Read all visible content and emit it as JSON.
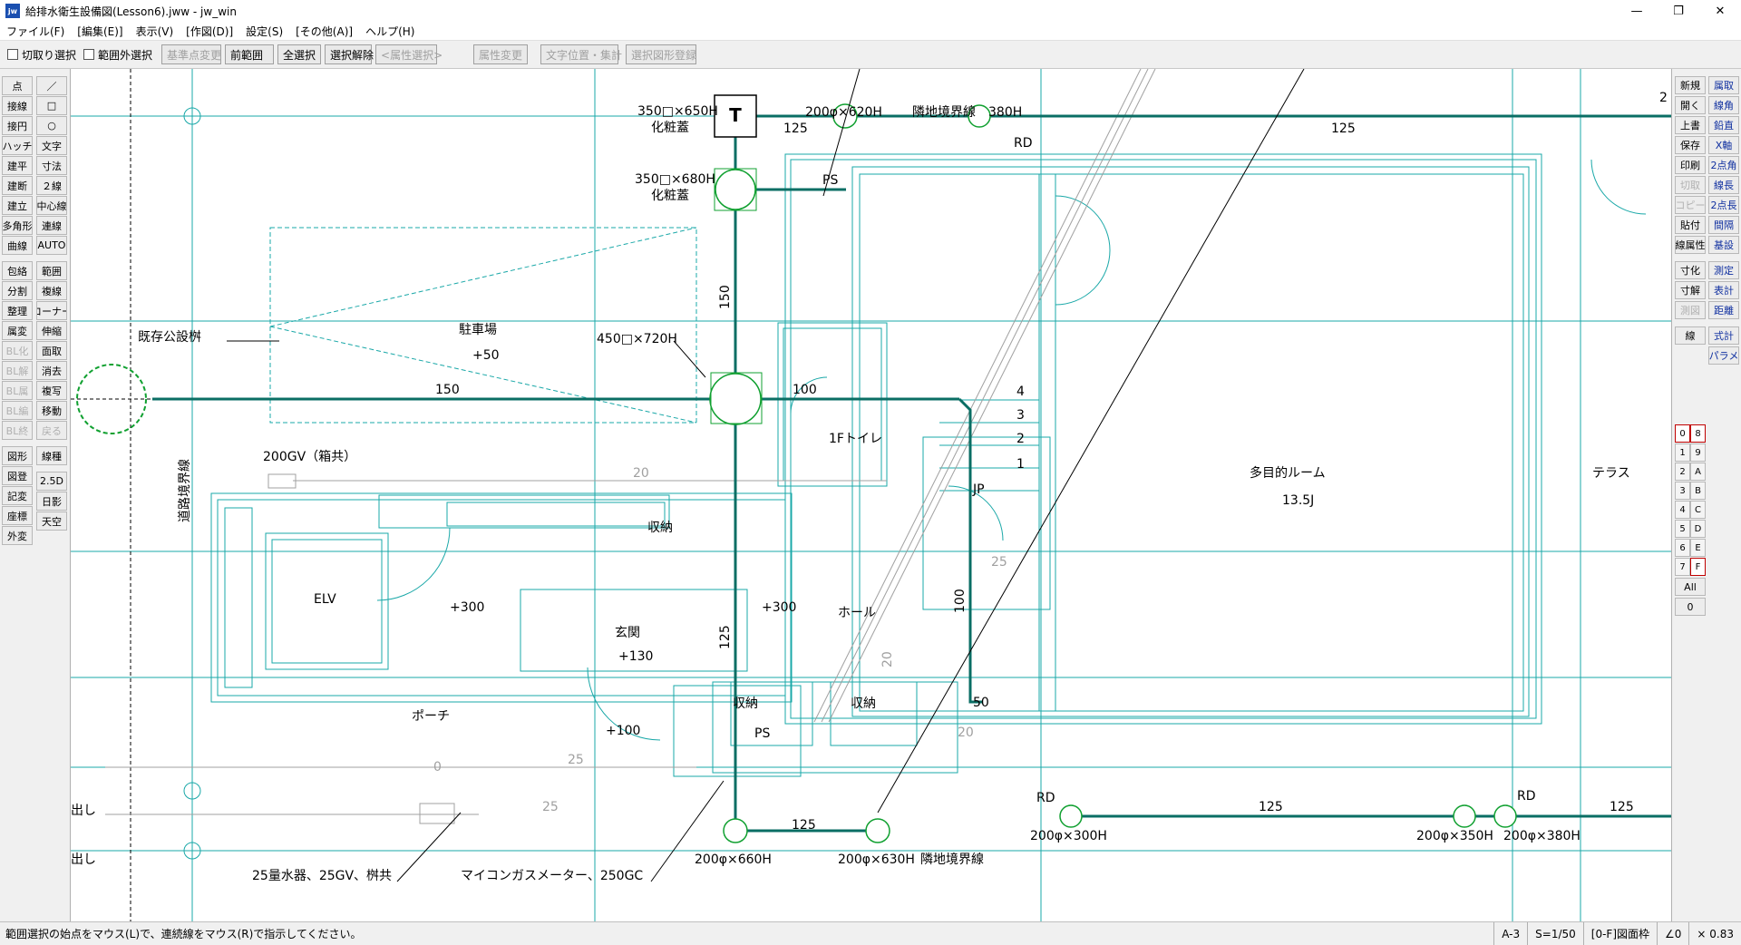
{
  "window": {
    "title": "給排水衛生設備図(Lesson6).jww - jw_win",
    "icon": "jw-app-icon"
  },
  "menubar": [
    "ファイル(F)",
    "[編集(E)]",
    "表示(V)",
    "[作図(D)]",
    "設定(S)",
    "[その他(A)]",
    "ヘルプ(H)"
  ],
  "toolbar": {
    "checkboxes": [
      "切取り選択",
      "範囲外選択"
    ],
    "buttons": [
      {
        "label": "基準点変更",
        "enabled": false
      },
      {
        "label": "前範囲",
        "enabled": true
      },
      {
        "label": "全選択",
        "enabled": true
      },
      {
        "label": "選択解除",
        "enabled": true
      },
      {
        "label": "<属性選択>",
        "enabled": false
      },
      {
        "label": "属性変更",
        "enabled": false
      },
      {
        "label": "文字位置・集計",
        "enabled": false
      },
      {
        "label": "選択図形登録",
        "enabled": false
      }
    ]
  },
  "left_tools": {
    "col_a": [
      "点",
      "接線",
      "接円",
      "ハッチ",
      "建平",
      "建断",
      "建立",
      "多角形",
      "曲線",
      "",
      "包絡",
      "分割",
      "整理",
      "属変",
      "BL化",
      "BL解",
      "BL属",
      "BL編",
      "BL終",
      "",
      "図形",
      "図登",
      "記変",
      "座標",
      "外変"
    ],
    "col_a_disabled": [
      "BL化",
      "BL解",
      "BL属",
      "BL編",
      "BL終"
    ],
    "col_b": [
      "／",
      "□",
      "○",
      "文字",
      "寸法",
      "２線",
      "中心線",
      "連線",
      "AUTO",
      "",
      "範囲",
      "複線",
      "コーナー",
      "伸縮",
      "面取",
      "消去",
      "複写",
      "移動",
      "戻る",
      "",
      "線種",
      "",
      "2.5D",
      "日影",
      "天空"
    ],
    "col_b_disabled": [
      "戻る"
    ]
  },
  "right_tools": {
    "col_a": [
      "新規",
      "開く",
      "上書",
      "保存",
      "印刷",
      "切取",
      "コピー",
      "貼付",
      "線属性",
      "",
      "寸化",
      "寸解",
      "測図",
      "",
      "線"
    ],
    "col_a_disabled": [
      "切取",
      "コピー",
      "測図"
    ],
    "col_b": [
      "属取",
      "線角",
      "鉛直",
      "X軸",
      "2点角",
      "線長",
      "2点長",
      "間隔",
      "基設",
      "",
      "測定",
      "表計",
      "距離",
      "",
      "式計",
      "パラメ"
    ],
    "layers_a": [
      "0",
      "1",
      "2",
      "3",
      "4",
      "5",
      "6",
      "7"
    ],
    "layers_b": [
      "8",
      "9",
      "A",
      "B",
      "C",
      "D",
      "E",
      "F"
    ],
    "layer_all": "All",
    "layer_zero": "0"
  },
  "drawing": {
    "labels": {
      "t_mark": "T",
      "box1_spec": "350□×650H",
      "box1_name": "化粧蓋",
      "box2_spec": "350□×680H",
      "box2_name": "化粧蓋",
      "box3_spec": "450□×720H",
      "top_spec1": "200φ×620H",
      "top_boundary": "隣地境界線",
      "top_spec2": "380H",
      "rd_top": "RD",
      "ps_top": "PS",
      "dim_125_a": "125",
      "dim_125_b": "125",
      "dim_150_v": "150",
      "dim_150_h": "150",
      "dim_100_h": "100",
      "dim_100_v": "100",
      "dim_125_v": "125",
      "dim_125_c": "125",
      "dim_125_d": "125",
      "dim_125_e": "125",
      "dim_50": "50",
      "dim_20": "20",
      "dim_20_b": "20",
      "dim_20_c": "20",
      "dim_25": "25",
      "dim_25_b": "25",
      "dim_25_c": "25",
      "dim_0": "0",
      "existing_basin": "既存公設桝",
      "road_boundary": "道路境界線",
      "parking": "駐車場",
      "parking_level": "+50",
      "gv200": "200GV（箱共）",
      "toilet": "1Fトイレ",
      "jp": "JP",
      "stair1": "1",
      "stair2": "2",
      "stair3": "3",
      "stair4": "4",
      "multi_room": "多目的ルーム",
      "multi_area": "13.5J",
      "terrace": "テラス",
      "storage1": "収納",
      "storage2": "収納",
      "storage3": "収納",
      "elv": "ELV",
      "plus300a": "+300",
      "plus300b": "+300",
      "hall": "ホール",
      "entrance": "玄関",
      "entrance_level": "+130",
      "porch": "ポーチ",
      "plus100": "+100",
      "ps_bottom": "PS",
      "rd_bl": "RD",
      "rd_br": "RD",
      "b_spec1": "200φ×660H",
      "b_spec2": "200φ×630H",
      "b_boundary": "隣地境界線",
      "b_spec3": "200φ×300H",
      "b_spec4": "200φ×350H",
      "b_spec5": "200φ×380H",
      "water_meter": "25量水器、25GV、桝共",
      "gas_meter": "マイコンガスメーター、250GC",
      "dashi1": "出し",
      "dashi2": "出し",
      "edge_2": "2"
    }
  },
  "statusbar": {
    "message": "範囲選択の始点をマウス(L)で、連続線をマウス(R)で指示してください。",
    "paper": "A-3",
    "scale": "S=1/50",
    "layer": "[0-F]図面枠",
    "angle": "∠0",
    "zoom": "× 0.83"
  },
  "colors": {
    "cyan": "#1aa8a8",
    "pipe": "#0a6e64",
    "green": "#10a030",
    "gray": "#a0a0a0",
    "black": "#000000"
  }
}
